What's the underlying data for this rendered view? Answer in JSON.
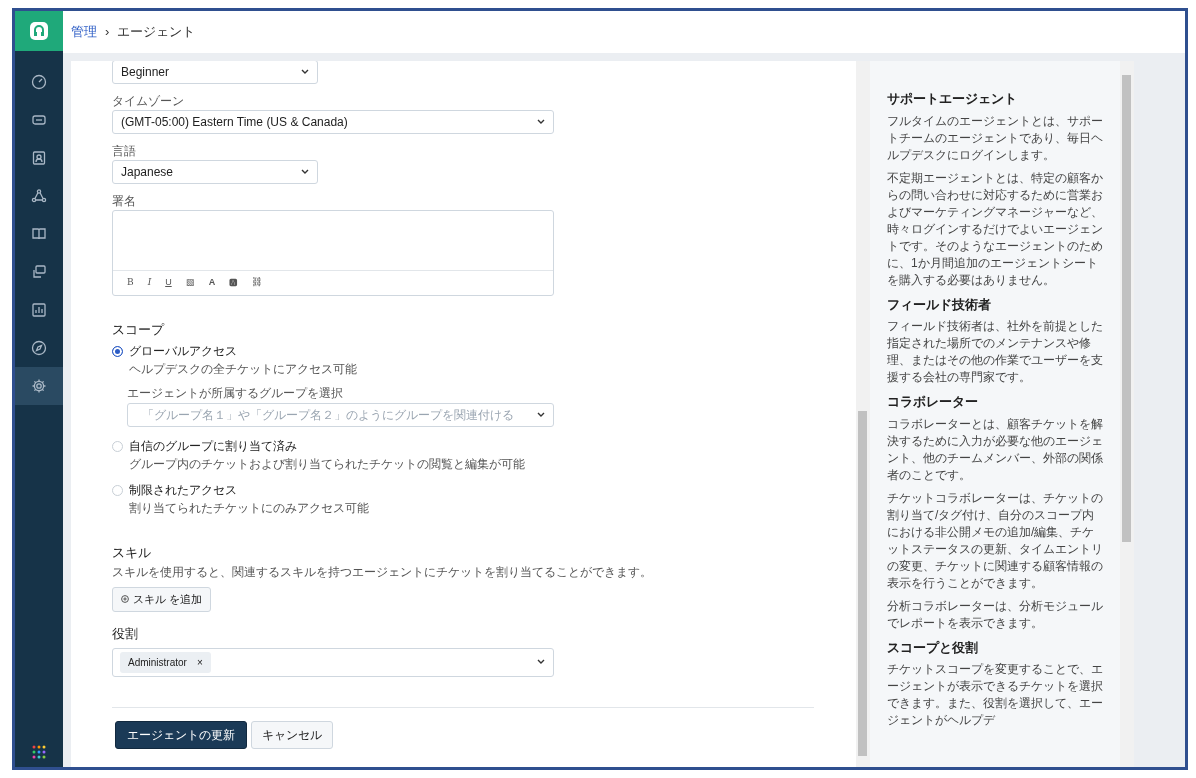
{
  "breadcrumb": {
    "parent": "管理",
    "separator": "›",
    "current": "エージェント"
  },
  "sidebar": {
    "items": [
      {
        "selected": false
      },
      {
        "selected": false
      },
      {
        "selected": false
      },
      {
        "selected": false
      },
      {
        "selected": false
      },
      {
        "selected": false
      },
      {
        "selected": false
      },
      {
        "selected": false
      },
      {
        "selected": true
      }
    ]
  },
  "form": {
    "level": {
      "value": "Beginner"
    },
    "timezone": {
      "label": "タイムゾーン",
      "value": "(GMT-05:00) Eastern Time (US & Canada)"
    },
    "language": {
      "label": "言語",
      "value": "Japanese"
    },
    "signature": {
      "label": "署名",
      "toolbar": [
        "B",
        "I",
        "U",
        "▧",
        "A",
        "🅰",
        "⛓"
      ]
    },
    "scope": {
      "title": "スコープ",
      "options": [
        {
          "label": "グローバルアクセス",
          "description": "ヘルプデスクの全チケットにアクセス可能",
          "selected": true
        },
        {
          "label": "自信のグループに割り当て済み",
          "description": "グループ内のチケットおよび割り当てられたチケットの閲覧と編集が可能",
          "selected": false
        },
        {
          "label": "制限されたアクセス",
          "description": "割り当てられたチケットにのみアクセス可能",
          "selected": false
        }
      ],
      "group_label": "エージェントが所属するグループを選択",
      "group_placeholder": "「グループ名１」や「グループ名２」のようにグループを関連付ける"
    },
    "skills": {
      "title": "スキル",
      "description": "スキルを使用すると、関連するスキルを持つエージェントにチケットを割り当てることができます。",
      "add_button": "スキル を追加"
    },
    "roles": {
      "title": "役割",
      "tags": [
        "Administrator"
      ],
      "remove": "×"
    },
    "buttons": {
      "submit": "エージェントの更新",
      "cancel": "キャンセル"
    }
  },
  "help": [
    {
      "title": "サポートエージェント",
      "paragraphs": [
        "フルタイムのエージェントとは、サポートチームのエージェントであり、毎日ヘルプデスクにログインします。",
        "不定期エージェントとは、特定の顧客からの問い合わせに対応するために営業およびマーケティングマネージャーなど、時々ログインするだけでよいエージェントです。そのようなエージェントのために、1か月間追加のエージェントシートを購入する必要はありません。"
      ]
    },
    {
      "title": "フィールド技術者",
      "paragraphs": [
        "フィールド技術者は、社外を前提とした指定された場所でのメンテナンスや修理、またはその他の作業でユーザーを支援する会社の専門家です。"
      ]
    },
    {
      "title": "コラボレーター",
      "paragraphs": [
        "コラボレーターとは、顧客チケットを解決するために入力が必要な他のエージェント、他のチームメンバー、外部の関係者のことです。",
        "チケットコラボレーターは、チケットの割り当て/タグ付け、自分のスコープ内における非公開メモの追加/編集、チケットステータスの更新、タイムエントリの変更、チケットに関連する顧客情報の表示を行うことができます。",
        "分析コラボレーターは、分析モジュールでレポートを表示できます。"
      ]
    },
    {
      "title": "スコープと役割",
      "paragraphs": [
        "チケットスコープを変更することで、エージェントが表示できるチケットを選択できます。また、役割を選択して、エージェントがヘルプデ"
      ]
    }
  ]
}
